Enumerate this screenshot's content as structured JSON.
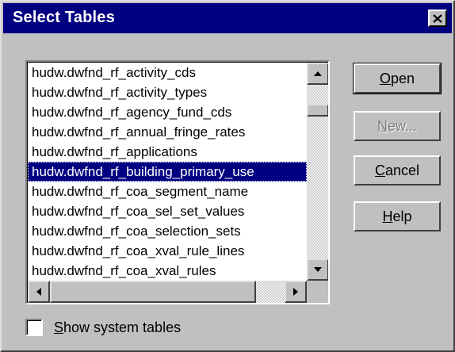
{
  "window": {
    "title": "Select Tables",
    "close_icon": "close-x-icon"
  },
  "table_list": {
    "items": [
      "hudw.dwfnd_rf_activity_cds",
      "hudw.dwfnd_rf_activity_types",
      "hudw.dwfnd_rf_agency_fund_cds",
      "hudw.dwfnd_rf_annual_fringe_rates",
      "hudw.dwfnd_rf_applications",
      "hudw.dwfnd_rf_building_primary_use",
      "hudw.dwfnd_rf_coa_segment_name",
      "hudw.dwfnd_rf_coa_sel_set_values",
      "hudw.dwfnd_rf_coa_selection_sets",
      "hudw.dwfnd_rf_coa_xval_rule_lines",
      "hudw.dwfnd_rf_coa_xval_rules"
    ],
    "selected_index": 5,
    "vertical_scroll_position": 0.12,
    "horizontal_scroll_position": 0.0
  },
  "buttons": {
    "open": {
      "mnemonic": "O",
      "rest": "pen"
    },
    "new": {
      "mnemonic": "N",
      "rest": "ew..."
    },
    "cancel": {
      "mnemonic": "C",
      "rest": "ancel"
    },
    "help": {
      "mnemonic": "H",
      "rest": "elp"
    }
  },
  "options": {
    "show_system_tables": {
      "mnemonic": "S",
      "rest": "how system tables",
      "checked": false
    }
  },
  "colors": {
    "title_bar": "#000080",
    "face": "#c0c0c0",
    "selection": "#000080"
  }
}
